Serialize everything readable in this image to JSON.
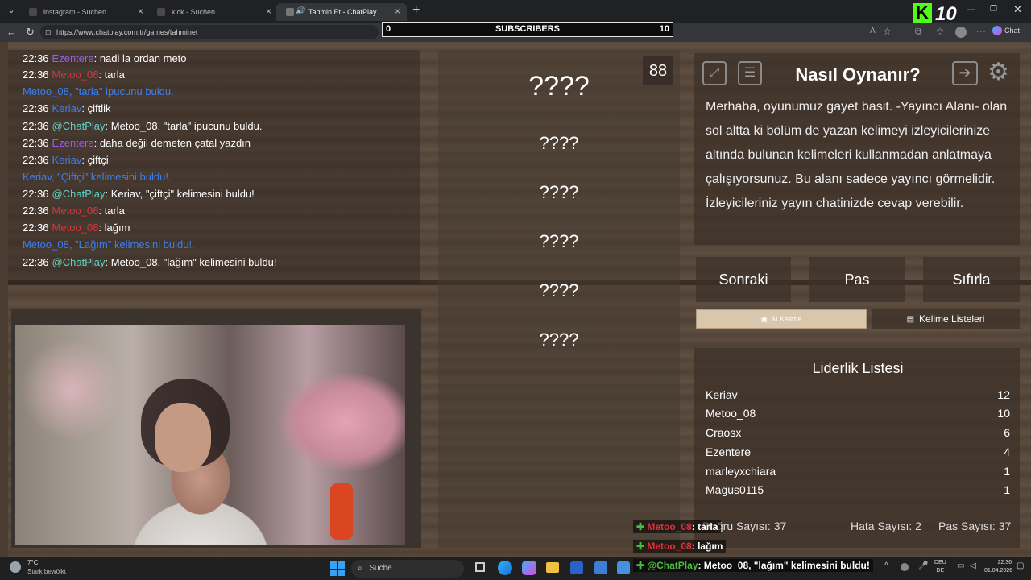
{
  "browser": {
    "tabs": [
      {
        "label": "instagram - Suchen"
      },
      {
        "label": "kick - Suchen"
      },
      {
        "label": "Tahmin Et - ChatPlay"
      }
    ],
    "url": "https://www.chatplay.com.tr/games/tahminet",
    "new_tab": "+",
    "chat_button": "Chat"
  },
  "subscribers": {
    "left": "0",
    "label": "SUBSCRIBERS",
    "right": "10"
  },
  "logo": {
    "letter": "K",
    "number": "10"
  },
  "chat": {
    "lines": [
      {
        "time": "22:36",
        "user": "Ezentere",
        "sep": ": ",
        "msg": "nadi la ordan meto"
      },
      {
        "time": "22:36",
        "user": "Metoo_08",
        "sep": ": ",
        "msg": "tarla"
      },
      {
        "time": "",
        "user": "Metoo_08, \"tarla\" ipucunu buldu.",
        "sep": "",
        "msg": ""
      },
      {
        "time": "22:36",
        "user": "Keriav",
        "sep": ": ",
        "msg": "çiftlik"
      },
      {
        "time": "22:36",
        "user": "@ChatPlay",
        "sep": ": ",
        "msg": "Metoo_08, \"tarla\" ipucunu buldu."
      },
      {
        "time": "22:36",
        "user": "Ezentere",
        "sep": ": ",
        "msg": "daha değil demeten çatal yazdın"
      },
      {
        "time": "22:36",
        "user": "Keriav",
        "sep": ": ",
        "msg": "çiftçi"
      },
      {
        "time": "",
        "user": "Keriav, \"Çiftçi\" kelimesini buldu!.",
        "sep": "",
        "msg": ""
      },
      {
        "time": "22:36",
        "user": "@ChatPlay",
        "sep": ": ",
        "msg": "Keriav, \"çiftçi\" kelimesini buldu!"
      },
      {
        "time": "22:36",
        "user": "Metoo_08",
        "sep": ": ",
        "msg": "tarla"
      },
      {
        "time": "22:36",
        "user": "Metoo_08",
        "sep": ": ",
        "msg": "lağım"
      },
      {
        "time": "",
        "user": "Metoo_08, \"Lağım\" kelimesini buldu!.",
        "sep": "",
        "msg": ""
      },
      {
        "time": "22:36",
        "user": "@ChatPlay",
        "sep": ": ",
        "msg": "Metoo_08, \"lağım\" kelimesini buldu!"
      }
    ]
  },
  "game": {
    "timer": "88",
    "main_word": "????",
    "hidden_words": [
      "????",
      "????",
      "????",
      "????",
      "????"
    ]
  },
  "howto": {
    "title": "Nasıl Oynanır?",
    "text": "Merhaba, oyunumuz gayet basit. -Yayıncı Alanı- olan sol altta ki bölüm de yazan kelimeyi izleyicilerinize altında bulunan kelimeleri kullanmadan anlatmaya çalışıyorsunuz. Bu alanı sadece yayıncı görmelidir. İzleyicileriniz yayın chatinizde cevap verebilir."
  },
  "controls": {
    "next": "Sonraki",
    "pass": "Pas",
    "reset": "Sıfırla",
    "ai_word": "AI Kelime",
    "word_lists": "Kelime Listeleri"
  },
  "leaderboard": {
    "title": "Liderlik Listesi",
    "rows": [
      {
        "name": "Keriav",
        "score": "12"
      },
      {
        "name": "Metoo_08",
        "score": "10"
      },
      {
        "name": "Craosx",
        "score": "6"
      },
      {
        "name": "Ezentere",
        "score": "4"
      },
      {
        "name": "marleyxchiara",
        "score": "1"
      },
      {
        "name": "Magus0115",
        "score": "1"
      }
    ]
  },
  "stats": {
    "correct": "Doğru Sayısı: 37",
    "errors": "Hata Sayısı: 2",
    "passes": "Pas Sayısı: 37"
  },
  "overlay_chat": [
    {
      "user": "Metoo_08",
      "msg": ": tarla"
    },
    {
      "user": "Metoo_08",
      "msg": ": lağım"
    },
    {
      "user": "@ChatPlay",
      "msg": ": Metoo_08, \"lağım\" kelimesini buldu!"
    }
  ],
  "taskbar": {
    "weather_temp": "7°C",
    "weather_text": "Stark bewölkt",
    "search": "Suche",
    "lang1": "DEU",
    "lang2": "DE",
    "time": "22:36",
    "date": "01.04.2026"
  },
  "colors": {
    "red": "#e0313b",
    "purple": "#9b5de5",
    "blue": "#3d7ff0",
    "teal": "#5fd3c4",
    "green": "#4dbb3f"
  }
}
